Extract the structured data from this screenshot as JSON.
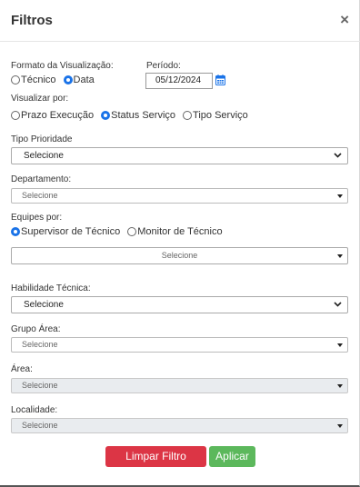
{
  "header": {
    "title": "Filtros",
    "close_glyph": "×"
  },
  "formato": {
    "label": "Formato da Visualização:",
    "options": [
      "Técnico",
      "Data"
    ],
    "selected": "Data"
  },
  "periodo": {
    "label": "Período:",
    "value": "05/12/2024",
    "icon": "calendar-icon"
  },
  "visualizar": {
    "label": "Visualizar por:",
    "options": [
      "Prazo Execução",
      "Status Serviço",
      "Tipo Serviço"
    ],
    "selected": "Status Serviço"
  },
  "tipo_prioridade": {
    "label": "Tipo Prioridade",
    "value": "Selecione"
  },
  "departamento": {
    "label": "Departamento:",
    "value": "Selecione"
  },
  "equipes": {
    "label": "Equipes por:",
    "options": [
      "Supervisor de Técnico",
      "Monitor de Técnico"
    ],
    "selected": "Supervisor de Técnico",
    "value": "Selecione"
  },
  "habilidade": {
    "label": "Habilidade Técnica:",
    "value": "Selecione"
  },
  "grupo_area": {
    "label": "Grupo Área:",
    "value": "Selecione"
  },
  "area": {
    "label": "Área:",
    "value": "Selecione",
    "disabled": true
  },
  "localidade": {
    "label": "Localidade:",
    "value": "Selecione",
    "disabled": true
  },
  "buttons": {
    "clear_label": "Limpar Filtro",
    "apply_label": "Aplicar"
  },
  "colors": {
    "accent": "#1a73e8",
    "danger": "#dc3545",
    "success": "#5cb85c",
    "disabled_bg": "#e9ecef"
  }
}
